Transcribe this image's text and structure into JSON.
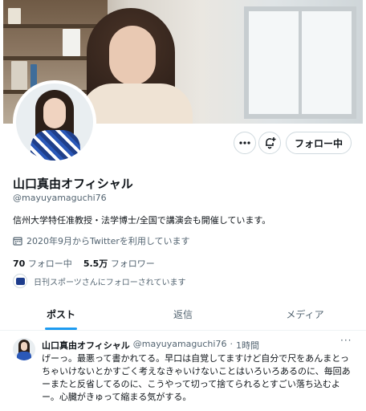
{
  "profile": {
    "name": "山口真由オフィシャル",
    "handle": "@mayuyamaguchi76",
    "bio": "信州大学特任准教授・法学博士/全国で講演会も開催しています。",
    "joined": "2020年9月からTwitterを利用しています",
    "following_count": "70",
    "following_label": "フォロー中",
    "followers_count": "5.5万",
    "followers_label": "フォロワー",
    "followed_by": "日刊スポーツさんにフォローされています"
  },
  "actions": {
    "more_icon": "ellipsis-icon",
    "notify_icon": "bell-plus-icon",
    "follow_label": "フォロー中"
  },
  "tabs": [
    {
      "label": "ポスト",
      "active": true
    },
    {
      "label": "返信",
      "active": false
    },
    {
      "label": "メディア",
      "active": false
    }
  ],
  "tweet": {
    "name": "山口真由オフィシャル",
    "handle": "@mayuyamaguchi76",
    "separator": "·",
    "time": "1時間",
    "more": "···",
    "text": "げーっ。最悪って書かれてる。早口は自覚してますけど自分で尺をあんまとっちゃいけないとかすごく考えなきゃいけないことはいろいろあるのに、毎回あーまたと反省してるのに、こうやって切って捨てられるとすごい落ち込むよー。心臓がきゅって縮まる気がする。"
  },
  "colors": {
    "accent": "#1d9bf0",
    "secondary_text": "#536471",
    "primary_text": "#0f1419",
    "border": "#cfd9de"
  }
}
